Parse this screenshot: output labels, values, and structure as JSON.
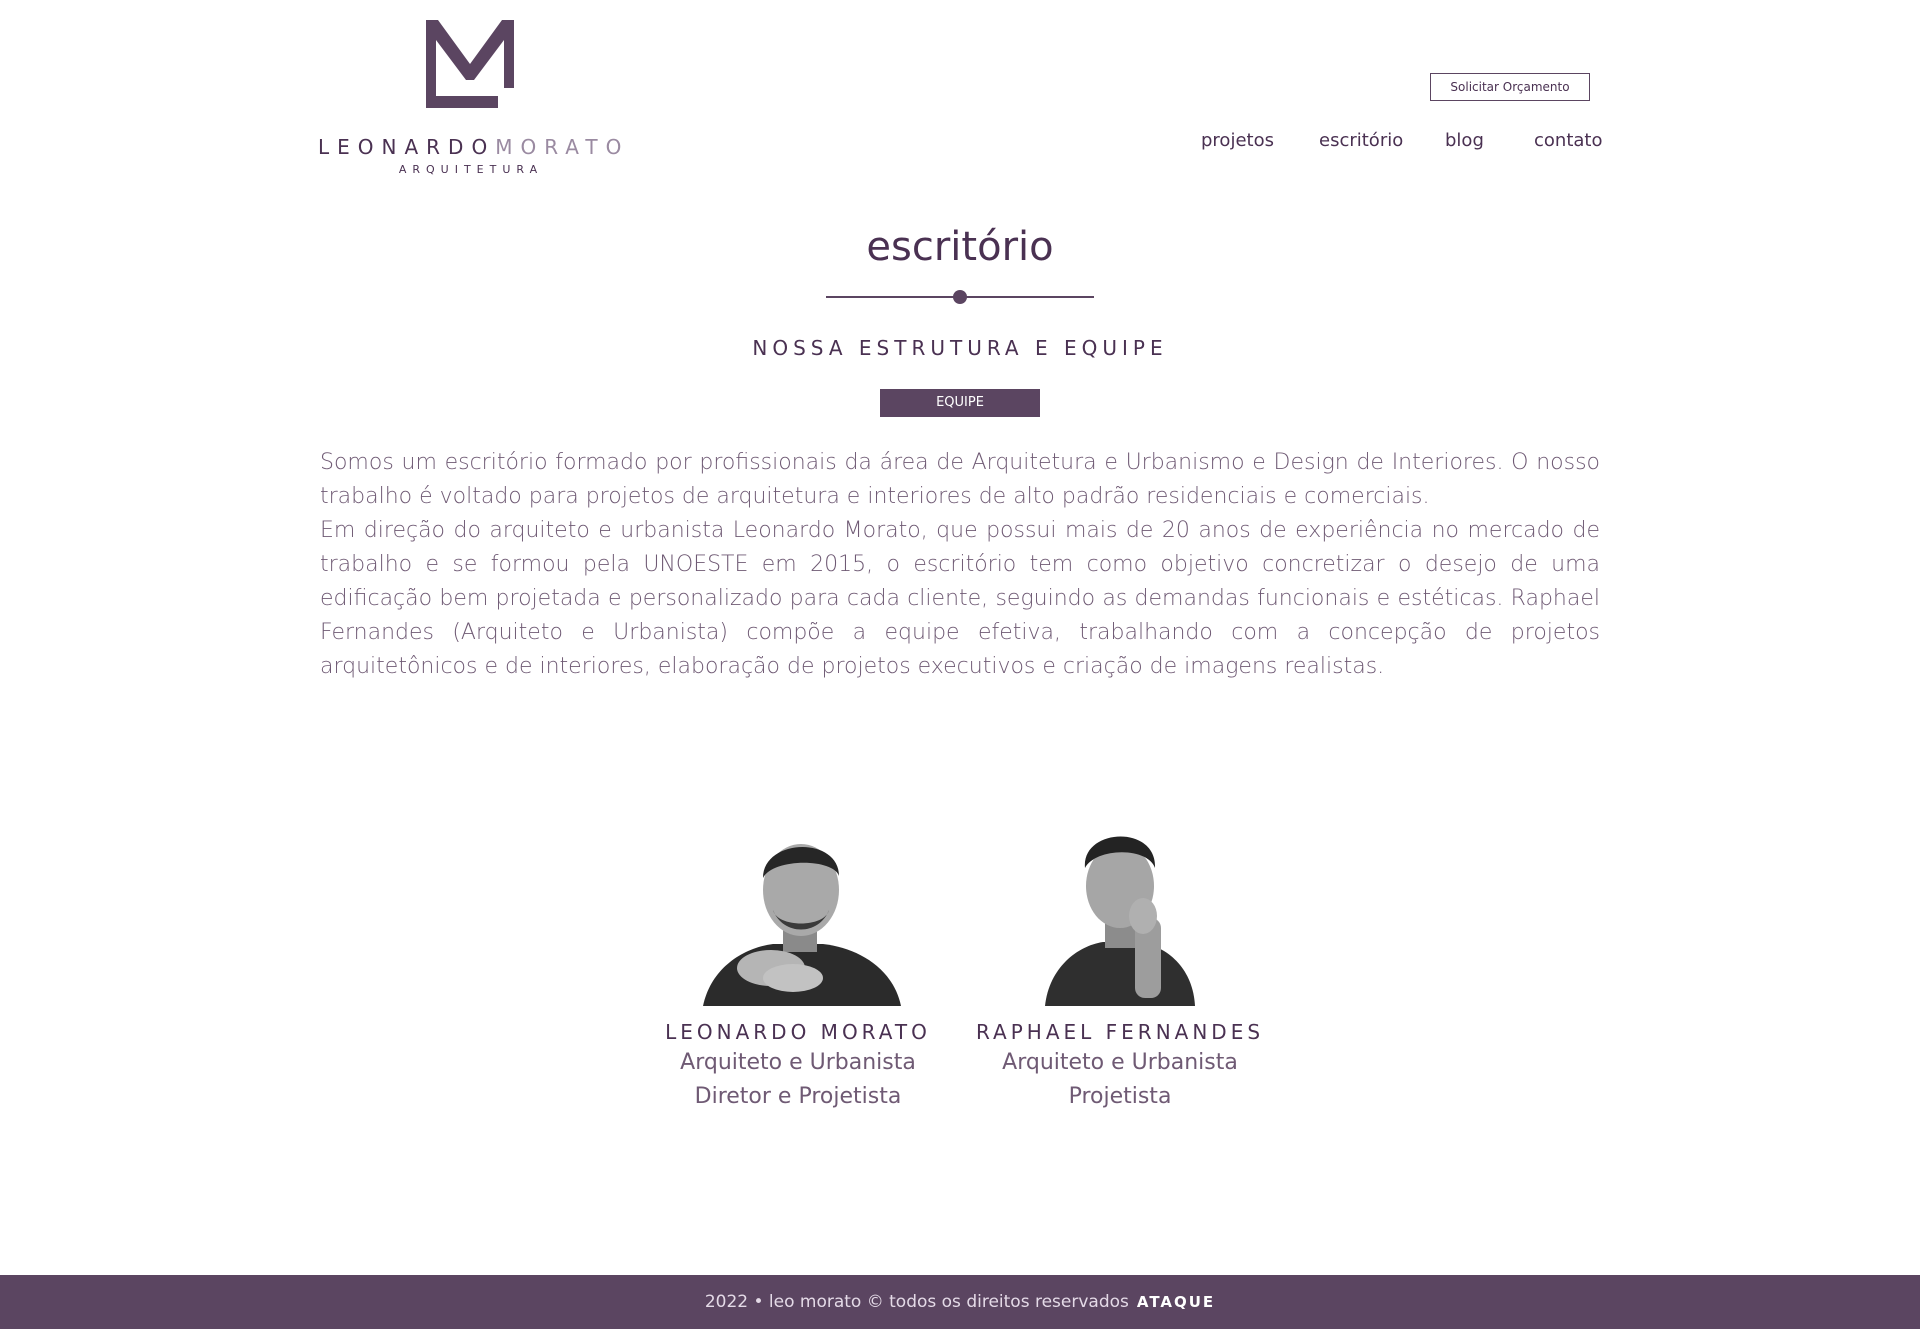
{
  "brand": {
    "logo_mark": "LM monogram",
    "name_first": "LEONARDO",
    "name_last": "MORATO",
    "subtitle": "ARQUITETURA"
  },
  "header": {
    "quote_button": "Solicitar Orçamento",
    "nav": [
      {
        "label": "projetos"
      },
      {
        "label": "escritório"
      },
      {
        "label": "blog"
      },
      {
        "label": "contato"
      }
    ]
  },
  "main": {
    "title": "escritório",
    "subtitle": "NOSSA ESTRUTURA E EQUIPE",
    "tag_button": "EQUIPE",
    "paragraphs": [
      "Somos um escritório formado por profissionais da área de Arquitetura e Urbanismo e Design de Interiores. O nosso trabalho é voltado para projetos de arquitetura e interiores de alto padrão residenciais e comerciais.",
      "Em direção do arquiteto e urbanista Leonardo Morato, que possui mais de 20 anos de experiência no mercado de trabalho e se formou pela UNOESTE em 2015, o escritório tem como objetivo concretizar o desejo de uma edificação bem projetada e personalizado para cada cliente, seguindo as demandas funcionais e estéticas. Raphael Fernandes (Arquiteto e Urbanista) compõe a equipe efetiva, trabalhando com a concepção de projetos arquitetônicos e de interiores, elaboração de projetos executivos e criação de imagens realistas."
    ]
  },
  "team": [
    {
      "name": "LEONARDO MORATO",
      "role": "Arquiteto e Urbanista",
      "position": "Diretor e Projetista"
    },
    {
      "name": "RAPHAEL FERNANDES",
      "role": "Arquiteto e Urbanista",
      "position": "Projetista"
    }
  ],
  "footer": {
    "text": "2022 • leo morato © todos os direitos reservados",
    "brand": "ATAQUE"
  },
  "colors": {
    "primary": "#5b4561",
    "text": "#6f5a74",
    "background": "#ffffff"
  }
}
